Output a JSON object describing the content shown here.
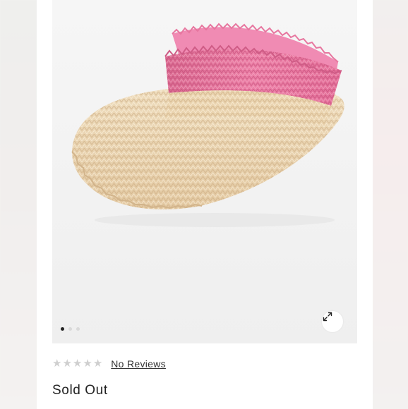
{
  "product": {
    "rating": {
      "stars_filled": 0,
      "stars_total": 5,
      "reviews_label": "No Reviews"
    },
    "availability": "Sold Out"
  },
  "gallery": {
    "images_count": 3,
    "active_index": 0
  },
  "colors": {
    "pink_band": "#e86fa0",
    "straw": "#e9d3b1",
    "star_empty": "#cfcfcf"
  },
  "icons": {
    "expand": "expand-icon",
    "star": "star-icon"
  }
}
